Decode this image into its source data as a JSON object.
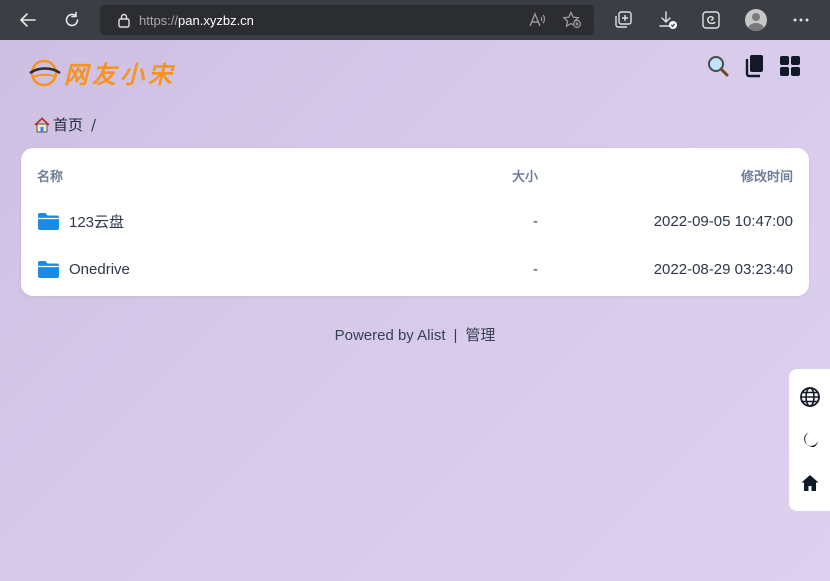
{
  "browser": {
    "url_protocol": "https://",
    "url_host": "pan.xyzbz.cn"
  },
  "site": {
    "logo_text": "网友小宋"
  },
  "breadcrumb": {
    "home_label": "首页",
    "separator": "/"
  },
  "table": {
    "headers": {
      "name": "名称",
      "size": "大小",
      "modified": "修改时间"
    },
    "rows": [
      {
        "name": "123云盘",
        "size": "-",
        "modified": "2022-09-05 10:47:00",
        "icon": "folder-icon"
      },
      {
        "name": "Onedrive",
        "size": "-",
        "modified": "2022-08-29 03:23:40",
        "icon": "folder-icon"
      }
    ]
  },
  "footer": {
    "powered_by": "Powered by Alist",
    "separator": "|",
    "manage": "管理"
  },
  "colors": {
    "folder": "#1e88e5",
    "logo": "#f7941d",
    "chrome": "#3b3f45"
  }
}
